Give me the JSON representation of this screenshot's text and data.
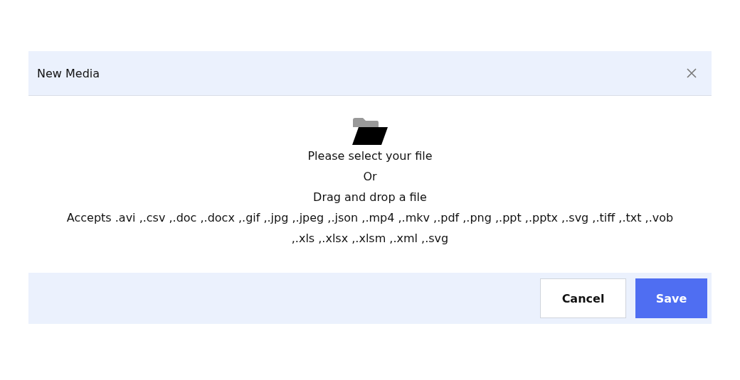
{
  "dialog": {
    "title": "New Media"
  },
  "dropzone": {
    "prompt": "Please select your file",
    "separator": "Or",
    "hint": "Drag and drop a file",
    "accepts": "Accepts .avi ,.csv ,.doc ,.docx ,.gif ,.jpg ,.jpeg ,.json ,.mp4 ,.mkv ,.pdf ,.png ,.ppt ,.pptx ,.svg ,.tiff ,.txt ,.vob ,.xls ,.xlsx ,.xlsm ,.xml ,.svg"
  },
  "buttons": [
    {
      "label": "Cancel",
      "kind": "secondary"
    },
    {
      "label": "Save",
      "kind": "primary"
    }
  ]
}
